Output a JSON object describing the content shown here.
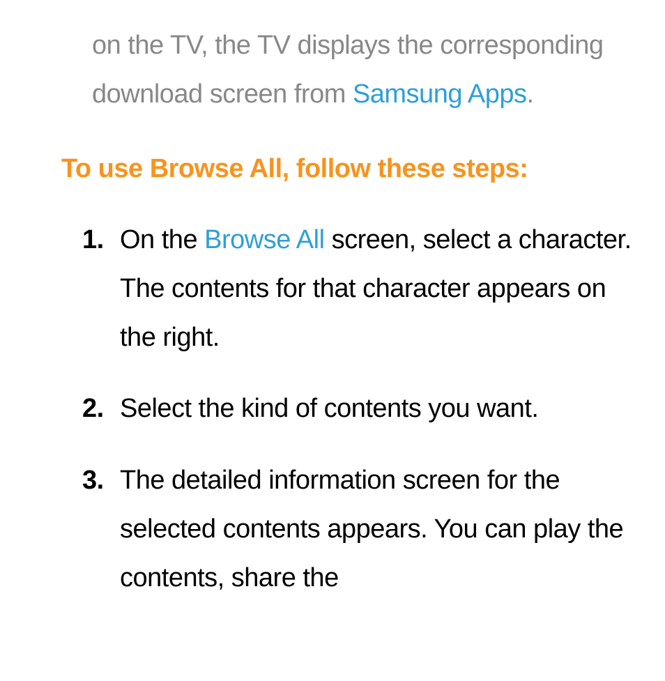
{
  "intro": {
    "text_before": "on the TV, the TV displays the corresponding download screen from ",
    "link": "Samsung Apps",
    "text_after": "."
  },
  "heading": "To use Browse All, follow these steps:",
  "steps": [
    {
      "num": "1.",
      "before": "On the ",
      "blue": "Browse All",
      "after": " screen, select a character. The contents for that character appears on the right."
    },
    {
      "num": "2.",
      "before": "Select the kind of contents you want.",
      "blue": "",
      "after": ""
    },
    {
      "num": "3.",
      "before": "The detailed information screen for the selected contents appears. You can play the contents, share the",
      "blue": "",
      "after": ""
    }
  ]
}
